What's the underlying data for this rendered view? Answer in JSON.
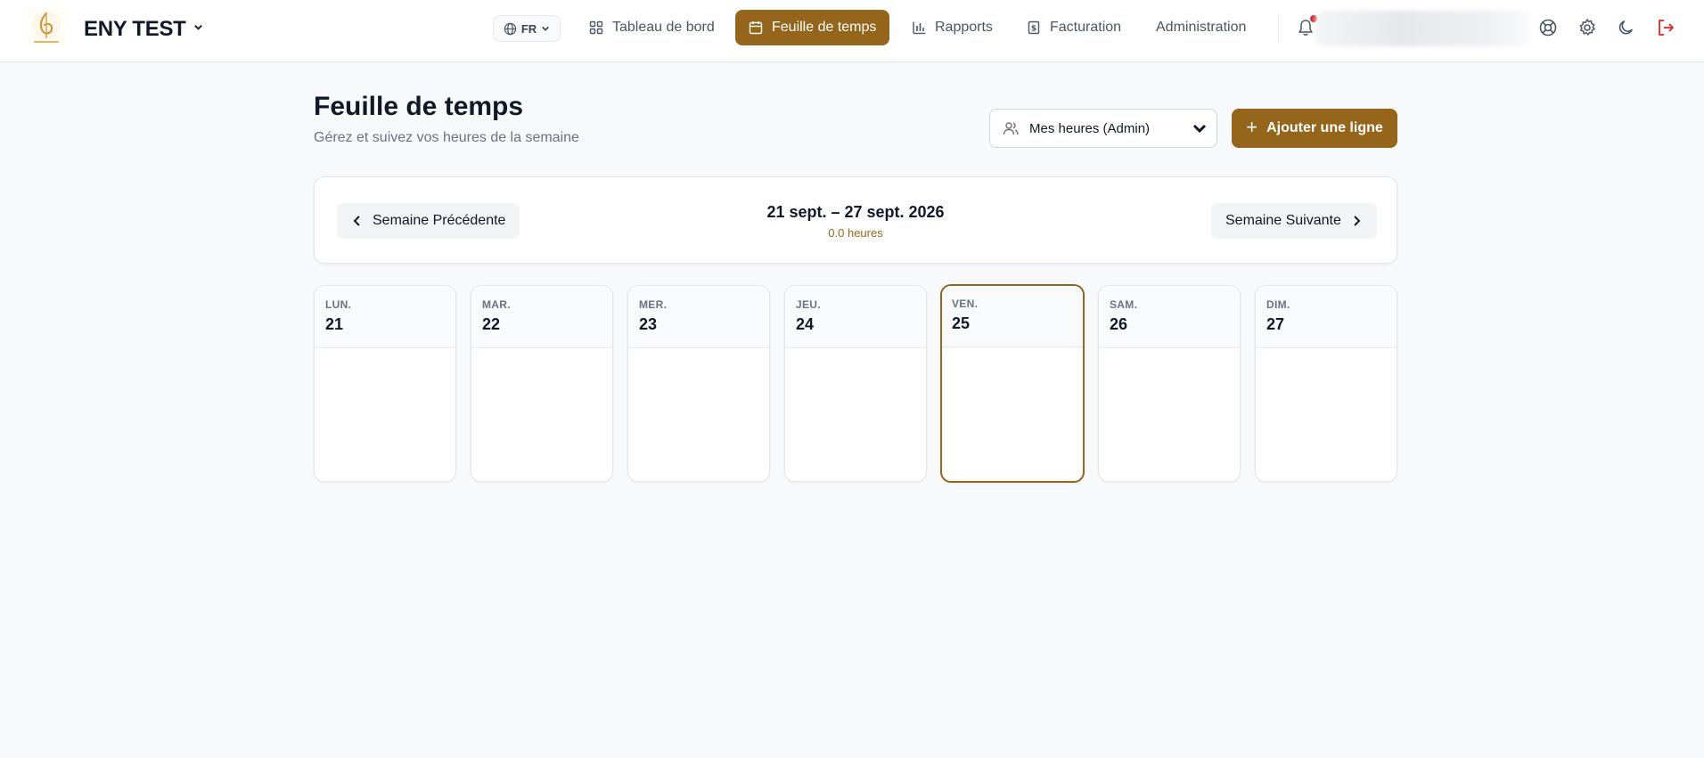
{
  "header": {
    "app_name": "ENY TEST",
    "language": "FR",
    "nav": [
      {
        "label": "Tableau de bord",
        "icon": "dashboard-icon",
        "active": false
      },
      {
        "label": "Feuille de temps",
        "icon": "calendar-icon",
        "active": true
      },
      {
        "label": "Rapports",
        "icon": "bar-chart-icon",
        "active": false
      },
      {
        "label": "Facturation",
        "icon": "invoice-icon",
        "active": false
      },
      {
        "label": "Administration",
        "icon": "",
        "active": false
      }
    ],
    "icons": [
      "bell-icon",
      "help-lifebuoy-icon",
      "gear-icon",
      "moon-icon",
      "logout-icon"
    ]
  },
  "page": {
    "title": "Feuille de temps",
    "subtitle": "Gérez et suivez vos heures de la semaine",
    "user_select_value": "Mes heures (Admin)",
    "add_line_label": "Ajouter une ligne"
  },
  "week": {
    "prev_label": "Semaine Précédente",
    "next_label": "Semaine Suivante",
    "range": "21 sept. – 27 sept. 2026",
    "total_hours": "0.0 heures"
  },
  "days": [
    {
      "name": "LUN.",
      "num": "21",
      "today": false
    },
    {
      "name": "MAR.",
      "num": "22",
      "today": false
    },
    {
      "name": "MER.",
      "num": "23",
      "today": false
    },
    {
      "name": "JEU.",
      "num": "24",
      "today": false
    },
    {
      "name": "VEN.",
      "num": "25",
      "today": true
    },
    {
      "name": "SAM.",
      "num": "26",
      "today": false
    },
    {
      "name": "DIM.",
      "num": "27",
      "today": false
    }
  ],
  "colors": {
    "accent": "#94651b",
    "background": "#f8f9fb",
    "logout": "#dc2626"
  }
}
